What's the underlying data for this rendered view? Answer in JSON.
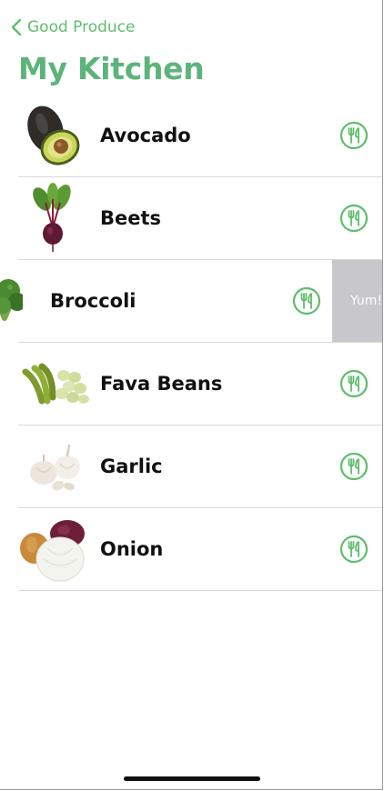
{
  "nav": {
    "back_label": "Good Produce",
    "back_icon": "chevron-left-icon",
    "title": "My Kitchen"
  },
  "colors": {
    "accent": "#5fbd6c",
    "title": "#5db47a",
    "swipe_action": "#c7c7cc"
  },
  "items": [
    {
      "name": "Avocado",
      "icon": "fork-knife-icon"
    },
    {
      "name": "Beets",
      "icon": "fork-knife-icon"
    },
    {
      "name": "Broccoli",
      "icon": "fork-knife-icon",
      "swipe_action": "Yum!"
    },
    {
      "name": "Fava Beans",
      "icon": "fork-knife-icon"
    },
    {
      "name": "Garlic",
      "icon": "fork-knife-icon"
    },
    {
      "name": "Onion",
      "icon": "fork-knife-icon"
    }
  ]
}
